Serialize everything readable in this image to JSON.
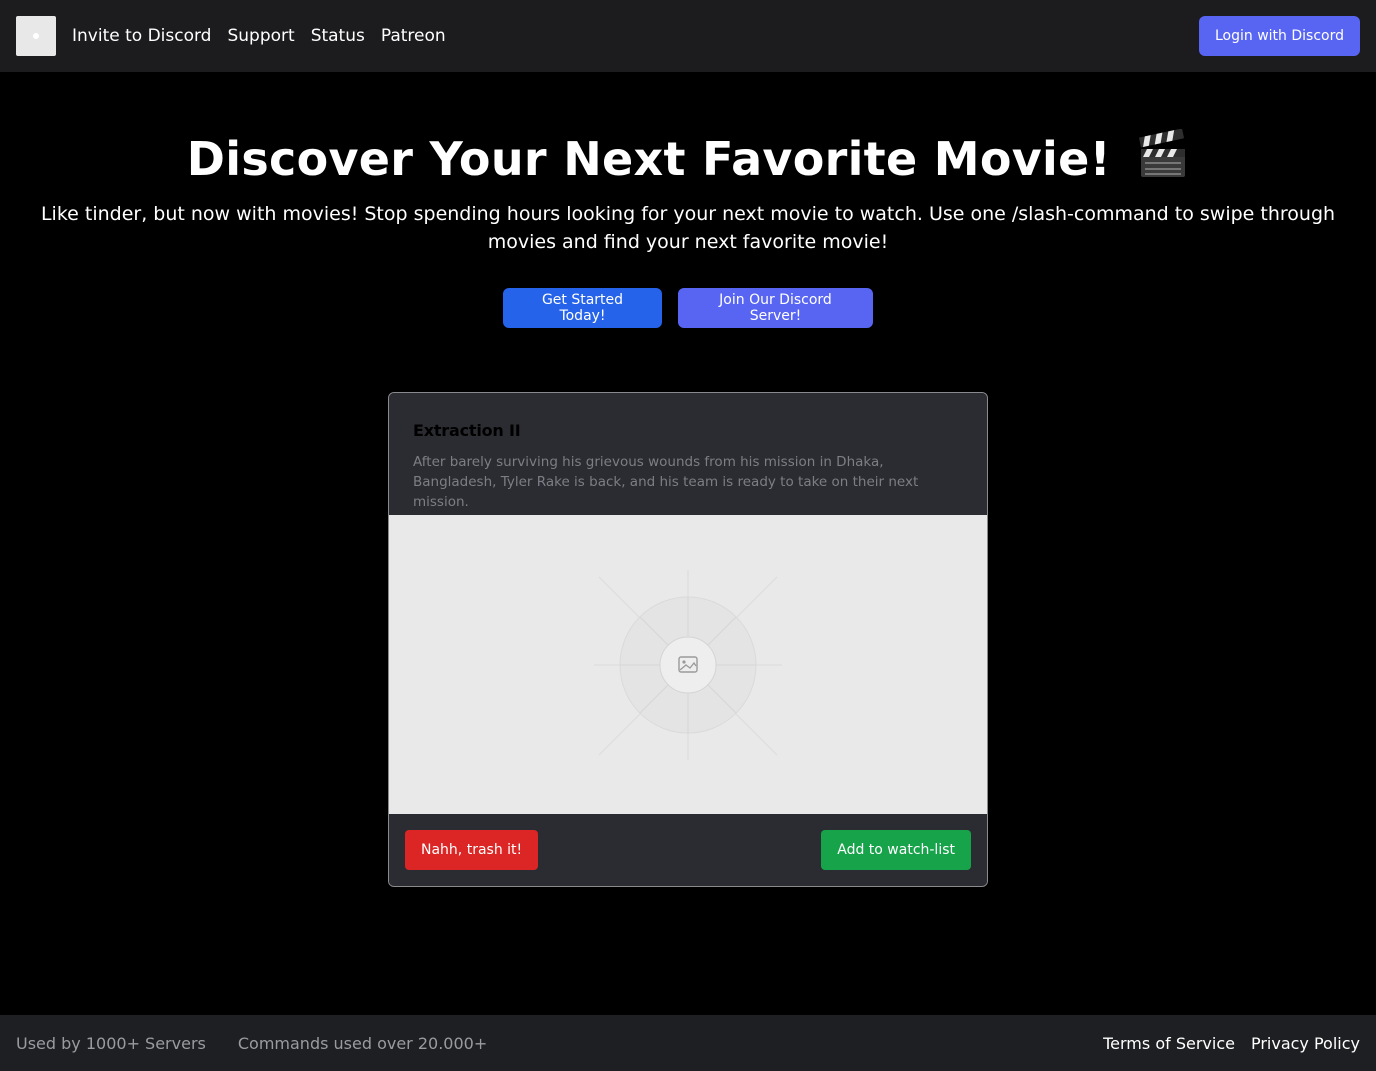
{
  "header": {
    "nav": [
      {
        "label": "Invite to Discord"
      },
      {
        "label": "Support"
      },
      {
        "label": "Status"
      },
      {
        "label": "Patreon"
      }
    ],
    "login_label": "Login with Discord"
  },
  "hero": {
    "title": "Discover Your Next Favorite Movie!",
    "title_icon": "clapperboard-icon",
    "subtitle": "Like tinder, but now with movies! Stop spending hours looking for your next movie to watch. Use one /slash-command to swipe through movies and find your next favorite movie!",
    "primary_cta": "Get Started Today!",
    "secondary_cta": "Join Our Discord Server!"
  },
  "card": {
    "title": "Extraction II",
    "description": "After barely surviving his grievous wounds from his mission in Dhaka, Bangladesh, Tyler Rake is back, and his team is ready to take on their next mission.",
    "image_icon": "image-placeholder-icon",
    "reject_label": "Nahh, trash it!",
    "accept_label": "Add to watch-list"
  },
  "footer": {
    "stats": [
      {
        "label": "Used by 1000+ Servers"
      },
      {
        "label": "Commands used over 20.000+"
      }
    ],
    "links": [
      {
        "label": "Terms of Service"
      },
      {
        "label": "Privacy Policy"
      }
    ]
  },
  "colors": {
    "discord": "#5865f2",
    "primary": "#2563eb",
    "danger": "#dc2626",
    "success": "#16a34a"
  }
}
